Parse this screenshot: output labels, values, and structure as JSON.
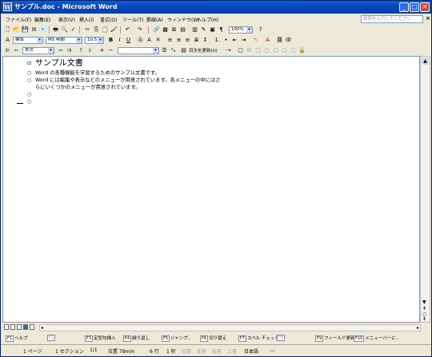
{
  "window": {
    "title": "サンプル.doc - Microsoft Word"
  },
  "menu": [
    "ファイル(F)",
    "編集(E)",
    "表示(V)",
    "挿入(I)",
    "書式(O)",
    "ツール(T)",
    "罫線(A)",
    "ウィンドウ(W)",
    "ヘルプ(H)"
  ],
  "help_search": {
    "placeholder": "質問を入力してください"
  },
  "toolbar": {
    "zoom": "100%",
    "style": "標準",
    "font": "MS 明朝",
    "size": "10.5",
    "outline_level": "本文",
    "toc_update": "目次を更新(U)"
  },
  "document": {
    "lines": [
      {
        "bullet": "⊡",
        "text": "サンプル文書"
      },
      {
        "bullet": "○",
        "text": "Word の各種機能を学習するためのサンプル文書です。"
      },
      {
        "bullet": "○",
        "text": "Word には編集や表示などのメニューが用意されています。各メニューの中にはさ"
      },
      {
        "bullet": "",
        "text": "らにいくつかのメニューが用意されています。"
      },
      {
        "bullet": "○",
        "text": ""
      },
      {
        "bullet": "○",
        "text": ""
      }
    ]
  },
  "function_keys": [
    {
      "num": "F1",
      "label": "ヘルプ",
      "dim": false
    },
    {
      "num": "F2",
      "label": "",
      "dim": true
    },
    {
      "num": "F3",
      "label": "定型句挿入",
      "dim": false
    },
    {
      "num": "F4",
      "label": "繰り返し",
      "dim": false
    },
    {
      "num": "F5",
      "label": "ジャンプ..",
      "dim": false
    },
    {
      "num": "F6",
      "label": "切り替え",
      "dim": false
    },
    {
      "num": "F7",
      "label": "スペル チェック..",
      "dim": false
    },
    {
      "num": "F8",
      "label": "",
      "dim": true
    },
    {
      "num": "F9",
      "label": "フィールド更新",
      "dim": false
    },
    {
      "num": "F10",
      "label": "メニューバーに..",
      "dim": false
    }
  ],
  "status": {
    "page": "1 ページ",
    "section": "1 セクション",
    "pages": "1/1",
    "position": "位置 78mm",
    "line": "6 行",
    "column": "1 桁",
    "rec": "記録",
    "trk": "変更",
    "ext": "拡張",
    "ovr": "上書",
    "lang": "日本語"
  }
}
